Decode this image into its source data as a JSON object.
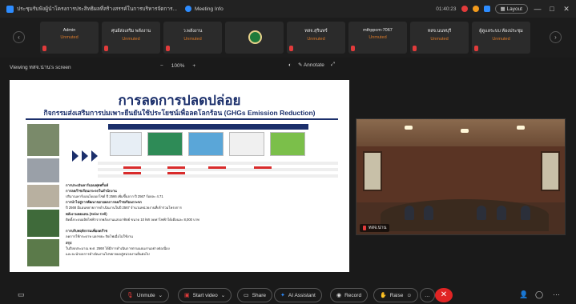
{
  "window": {
    "title": "ประชุมรับฟังผู้นำโครงการประสิทธิผลที่สร้างสรรค์ในการบริหารจัดการ...",
    "subtitle": "Meeting Info",
    "time": "01:40:23",
    "layout_label": "Layout",
    "minimize": "—",
    "maximize": "□",
    "close": "✕"
  },
  "participants": [
    {
      "name": "Admin",
      "status": "Unmuted"
    },
    {
      "name": "ศุนย์ส่งเสริม พลังงาน",
      "status": "Unmuted"
    },
    {
      "name": "ว.พลังงาน",
      "status": "Unmuted"
    },
    {
      "name": "",
      "status": ""
    },
    {
      "name": "ทสจ.สุรินทร์",
      "status": "Unmuted"
    },
    {
      "name": "mthppcm-7067",
      "status": "Unmuted"
    },
    {
      "name": "ทสจ.นนทบุรี",
      "status": "Unmuted"
    },
    {
      "name": "ผู้ดูแลระบบ ห้องประชุม",
      "status": "Unmuted"
    }
  ],
  "strip_nav": {
    "prev": "‹",
    "next": "›"
  },
  "viewbar": {
    "viewing": "Viewing ทสจ.น่าน's screen",
    "zoom": "100%",
    "zoom_minus": "−",
    "zoom_plus": "+",
    "annotate": "Annotate"
  },
  "slide": {
    "title": "การลดการปลดปล่อย",
    "subtitle": "กิจกรรมส่งเสริมการบ่มเพาะยืนยันใช้ประโยชน์เพื่อลดโลกร้อน (GHGs Emission Reduction)",
    "lines": [
      "การประเมินคาร์บอนฟุตพริ้นท์",
      "การลดก๊าซเรือนกระจกในสำนักงาน",
      "ปริมาณคาร์บอนไดออกไซด์ ปี 2566 เพิ่มขึ้นจาก ปี 2567 ร้อยละ 4.71",
      "การนำไปสู่การพัฒนาขยายผลการลดก๊าซเรือนกระจก",
      "ปี 2568 มีแผนขยายการดำเนินงานในปี 2567 จำนวนหน่วยงานที่เข้าร่วมโครงการ",
      "พลังงานทดแทน (Solar Cell)",
      "ติดตั้งระบบผลิตไฟฟ้าจากพลังงานแสงอาทิตย์ ขนาด 10 kW ลดค่าไฟฟ้าได้เดือนละ 8,000 บาท",
      "การปรับพฤติกรรมเพื่อลดก๊าซ",
      "ลดการใช้กระดาษ แยกขยะ ปิดไฟเมื่อไม่ใช้งาน",
      "สรุป",
      "ในปีงบประมาณ พ.ศ. 2568 ได้มีการดำเนินการตามแผนงานอย่างต่อเนื่อง",
      "และจะนำผลการดำเนินงานไปขยายผลสู่หน่วยงานอื่นต่อไป"
    ]
  },
  "video": {
    "name": "ทสจ.น่าน"
  },
  "controls": {
    "unmute": "Unmute",
    "start_video": "Start video",
    "share": "Share",
    "ai_assistant": "AI Assistant",
    "record": "Record",
    "raise": "Raise",
    "more": "…",
    "leave": "✕"
  }
}
